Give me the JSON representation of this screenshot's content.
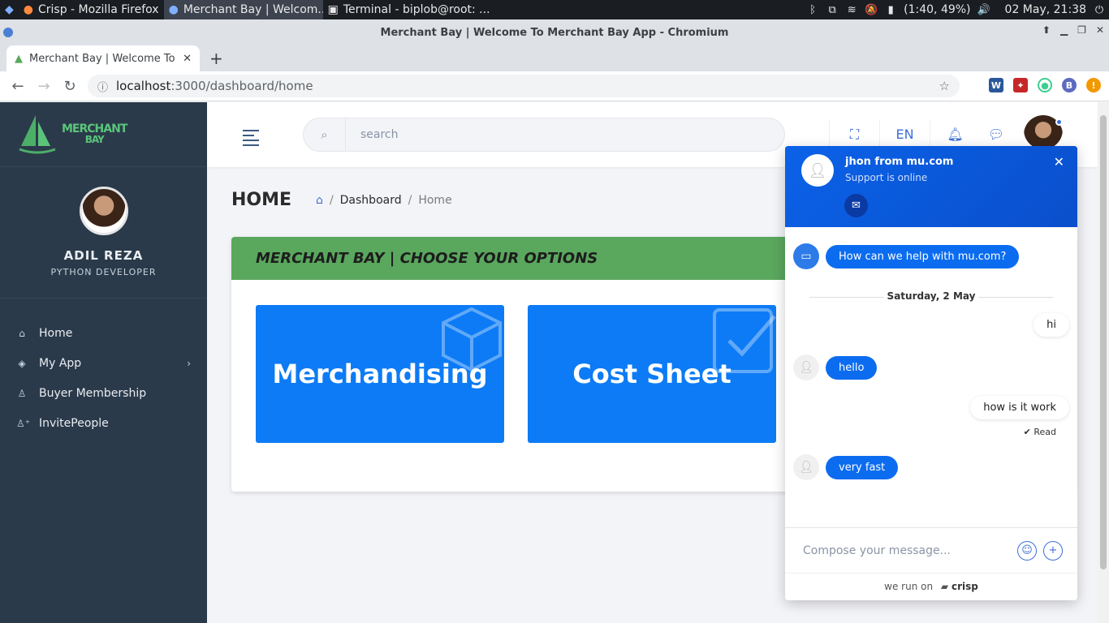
{
  "taskbar": {
    "tasks": [
      "Crisp - Mozilla Firefox",
      "Merchant Bay | Welcom...",
      "Terminal - biplob@root: ..."
    ],
    "battery": "(1:40, 49%)",
    "clock": "02 May, 21:38"
  },
  "browser": {
    "window_title": "Merchant Bay | Welcome To Merchant Bay App - Chromium",
    "tab_title": "Merchant Bay | Welcome To",
    "url_host": "localhost",
    "url_path": ":3000/dashboard/home",
    "profile_initial": "B",
    "ext_label": "W"
  },
  "sidebar": {
    "logo_line1": "MERCHANT",
    "logo_line2": "BAY",
    "profile_name": "ADIL REZA",
    "profile_role": "PYTHON DEVELOPER",
    "items": [
      {
        "label": "Home",
        "icon": "home-icon"
      },
      {
        "label": "My App",
        "icon": "layers-icon"
      },
      {
        "label": "Buyer Membership",
        "icon": "user-icon"
      },
      {
        "label": "InvitePeople",
        "icon": "user-plus-icon"
      }
    ]
  },
  "topbar": {
    "search_placeholder": "search",
    "language": "EN"
  },
  "main": {
    "title": "HOME",
    "breadcrumb": [
      "Dashboard",
      "Home"
    ],
    "card_title": "MERCHANT BAY | CHOOSE YOUR OPTIONS",
    "tiles": [
      "Merchandising",
      "Cost Sheet"
    ]
  },
  "chat": {
    "agent_name": "jhon from mu.com",
    "agent_status": "Support is online",
    "date": "Saturday, 2 May",
    "messages": [
      {
        "from": "bot",
        "text": "How can we help with mu.com?"
      },
      {
        "from": "user",
        "text": "hi"
      },
      {
        "from": "agent",
        "text": "hello"
      },
      {
        "from": "user",
        "text": "how is it work"
      },
      {
        "from": "agent",
        "text": "very fast"
      }
    ],
    "read_label": "Read",
    "compose_placeholder": "Compose your message...",
    "footer_prefix": "we run on",
    "footer_brand": "crisp"
  },
  "colors": {
    "sidebar_bg": "#2b3a4a",
    "card_header": "#5aa75e",
    "tile_blue": "#0d7bf5",
    "chat_header": "#0a5ee0"
  }
}
